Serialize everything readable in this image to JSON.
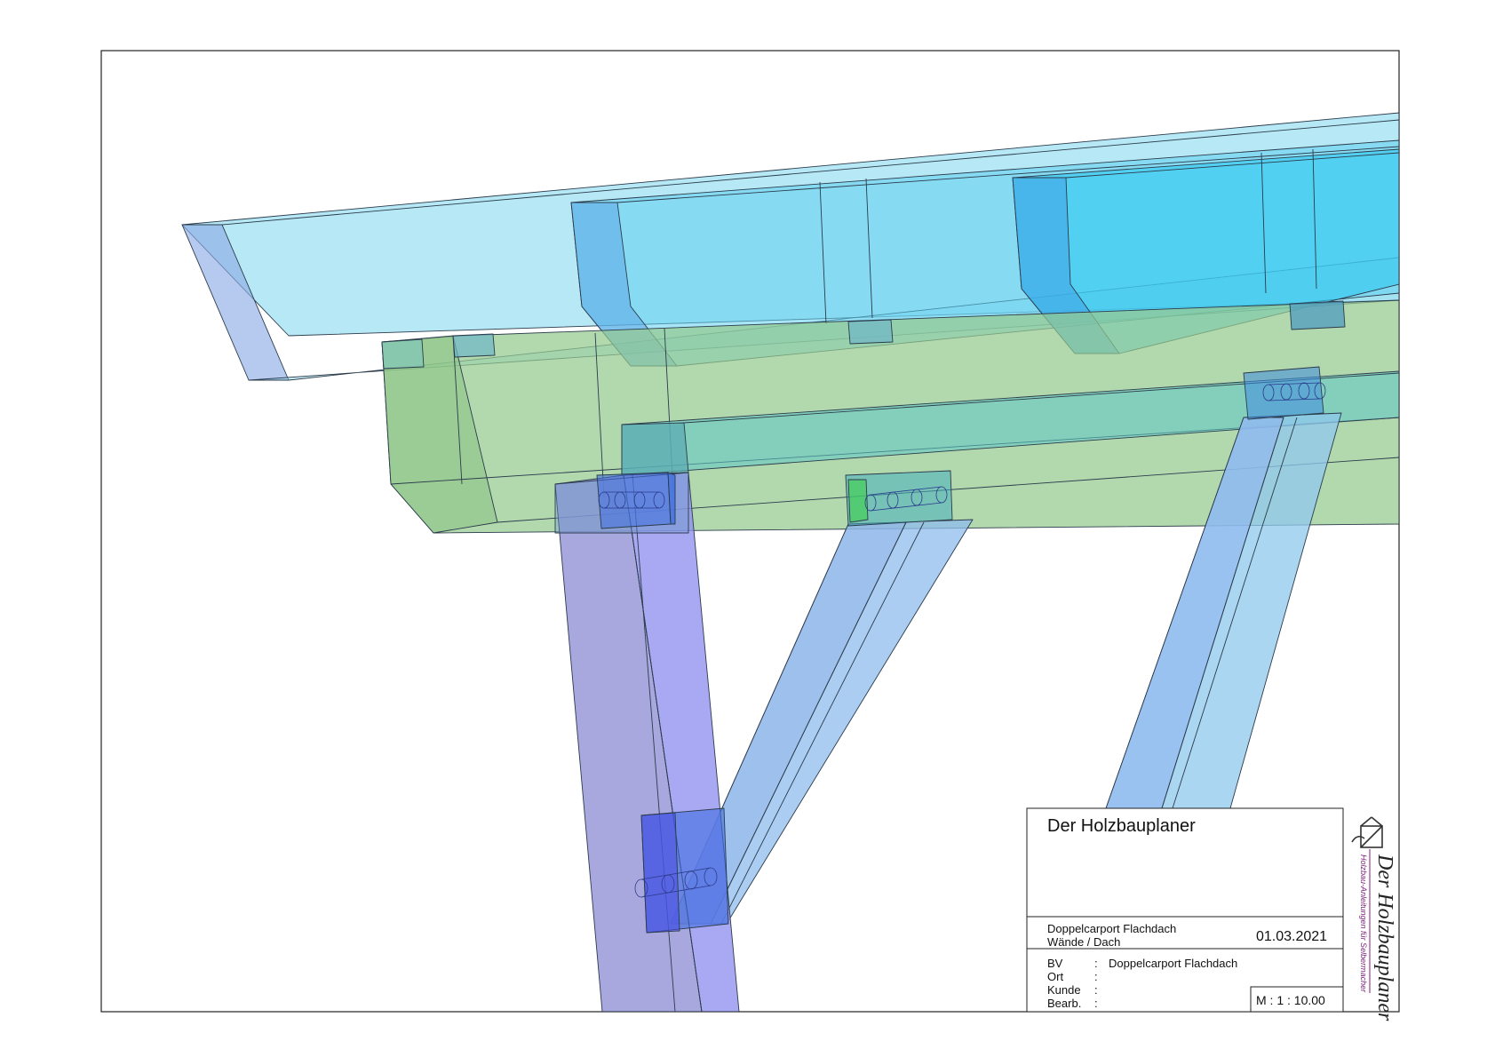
{
  "title_block": {
    "company": "Der Holzbauplaner",
    "project_line1": "Doppelcarport Flachdach",
    "project_line2": "Wände / Dach",
    "date": "01.03.2021",
    "fields": [
      {
        "label": "BV",
        "sep": ":",
        "value": "Doppelcarport Flachdach"
      },
      {
        "label": "Ort",
        "sep": ":",
        "value": ""
      },
      {
        "label": "Kunde",
        "sep": ":",
        "value": ""
      },
      {
        "label": "Bearb.",
        "sep": ":",
        "value": ""
      }
    ],
    "scale": "M : 1 : 10.00"
  },
  "logo": {
    "name": "Der Holzbauplaner",
    "tagline": "Holzbau-Anleitungen für Selbermacher",
    "color": "#7a1f7a"
  },
  "colors": {
    "rafter": "#8fdcf0",
    "rafter_dark": "#3fc8ee",
    "purlin": "#94c98f",
    "post": "#8f8fe6",
    "brace": "#8fbcee",
    "connector": "#3f6ee0",
    "edge": "#2b3b4b"
  }
}
